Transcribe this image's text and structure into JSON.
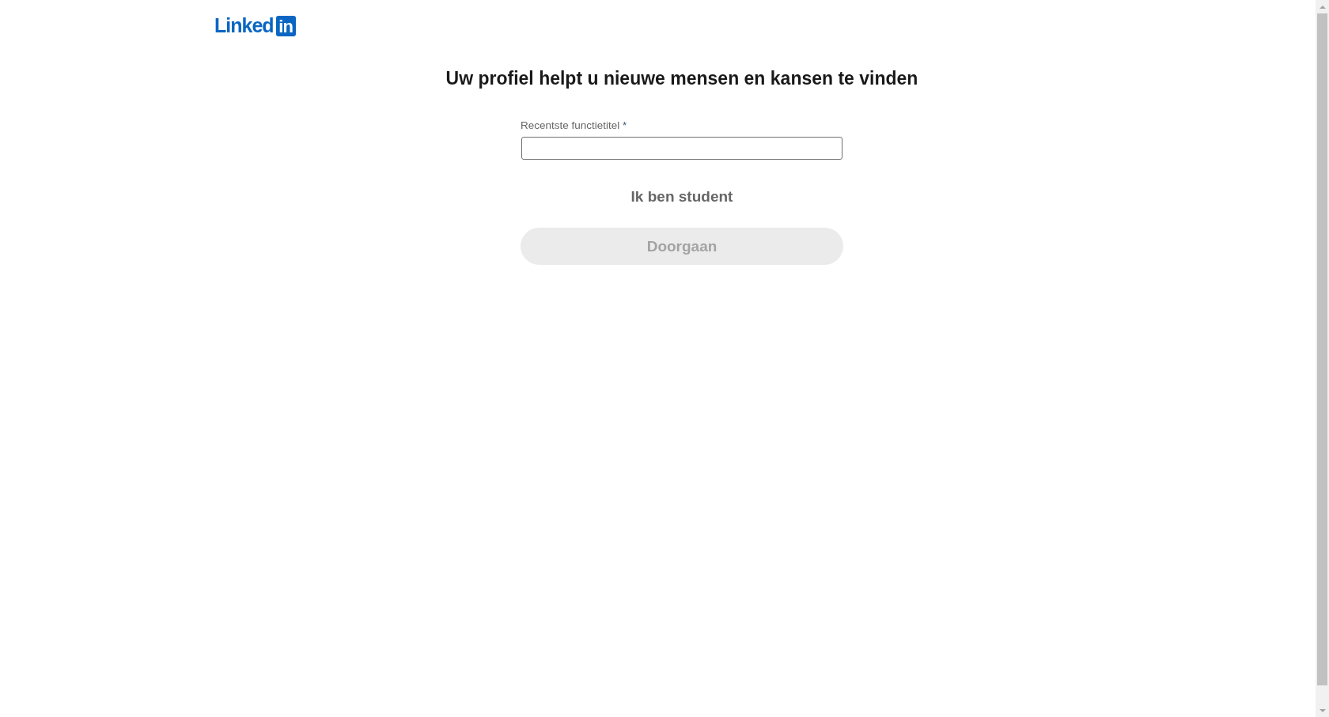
{
  "logo": {
    "wordmark": "Linked",
    "mark": "in"
  },
  "heading": "Uw profiel helpt u nieuwe mensen en kansen te vinden",
  "form": {
    "field": {
      "label": "Recentste functietitel",
      "required_marker": "*"
    },
    "student_toggle": {
      "label": "Ik ben student"
    },
    "continue_button": {
      "label": "Doorgaan",
      "disabled": true
    }
  }
}
